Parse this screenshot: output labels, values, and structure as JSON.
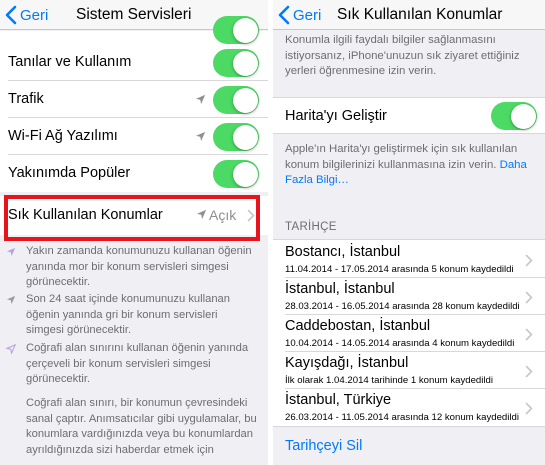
{
  "left": {
    "back_label": "Geri",
    "title": "Sistem Servisleri",
    "rows": [
      {
        "label": "Tanılar ve Kullanım"
      },
      {
        "label": "Trafik"
      },
      {
        "label": "Wi-Fi Ağ Yazılımı"
      },
      {
        "label": "Yakınımda Popüler"
      }
    ],
    "frequent": {
      "label": "Sık Kullanılan Konumlar",
      "value": "Açık"
    },
    "footer": [
      {
        "text": "Yakın zamanda konumunuzu kullanan öğenin yanında mor bir konum servisleri simgesi görünecektir.",
        "arrow_color": "#b9a3de"
      },
      {
        "text": "Son 24 saat içinde konumunuzu kullanan öğenin yanında gri bir konum servisleri simgesi görünecektir.",
        "arrow_color": "#9b9ba0"
      },
      {
        "text": "Coğrafi alan sınırını kullanan öğenin yanında çerçeveli bir konum servisleri simgesi görünecektir.",
        "arrow_color": "#b9a3de"
      },
      {
        "text": "Coğrafi alan sınırı, bir konumun çevresindeki sanal çaptır. Anımsatıcılar gibi uygulamalar, bu konumlara vardığınızda veya bu konumlardan ayrıldığınızda sizi haberdar etmek için"
      }
    ]
  },
  "right": {
    "back_label": "Geri",
    "title": "Sık Kullanılan Konumlar",
    "intro": "Konumla ilgili faydalı bilgiler sağlanmasını istiyorsanız, iPhone'unuzun sık ziyaret ettiğiniz yerleri öğrenmesine izin verin.",
    "improve_label": "Harita'yı Geliştir",
    "improve_desc": "Apple'ın Harita'yı geliştirmek için sık kullanılan konum bilgilerinizi kullanmasına izin verin.",
    "more_info_link": "Daha Fazla Bilgi…",
    "history_header": "TARİHÇE",
    "history": [
      {
        "title": "Bostancı, İstanbul",
        "subtitle": "11.04.2014 - 17.05.2014 arasında 5 konum kaydedildi"
      },
      {
        "title": "İstanbul, İstanbul",
        "subtitle": "28.03.2014 - 16.05.2014 arasında 28 konum kaydedildi"
      },
      {
        "title": "Caddebostan, İstanbul",
        "subtitle": "10.04.2014 - 14.05.2014 arasında 4 konum kaydedildi"
      },
      {
        "title": "Kayışdağı, İstanbul",
        "subtitle": "İlk olarak 1.04.2014 tarihinde 1 konum kaydedildi"
      },
      {
        "title": "İstanbul, Türkiye",
        "subtitle": "26.03.2014 - 11.05.2014 arasında 12 konum kaydedildi"
      }
    ],
    "clear_label": "Tarihçeyi Sil"
  },
  "colors": {
    "ios_blue": "#007aff",
    "switch_green": "#4cd964",
    "highlight_red": "#e8141c"
  }
}
